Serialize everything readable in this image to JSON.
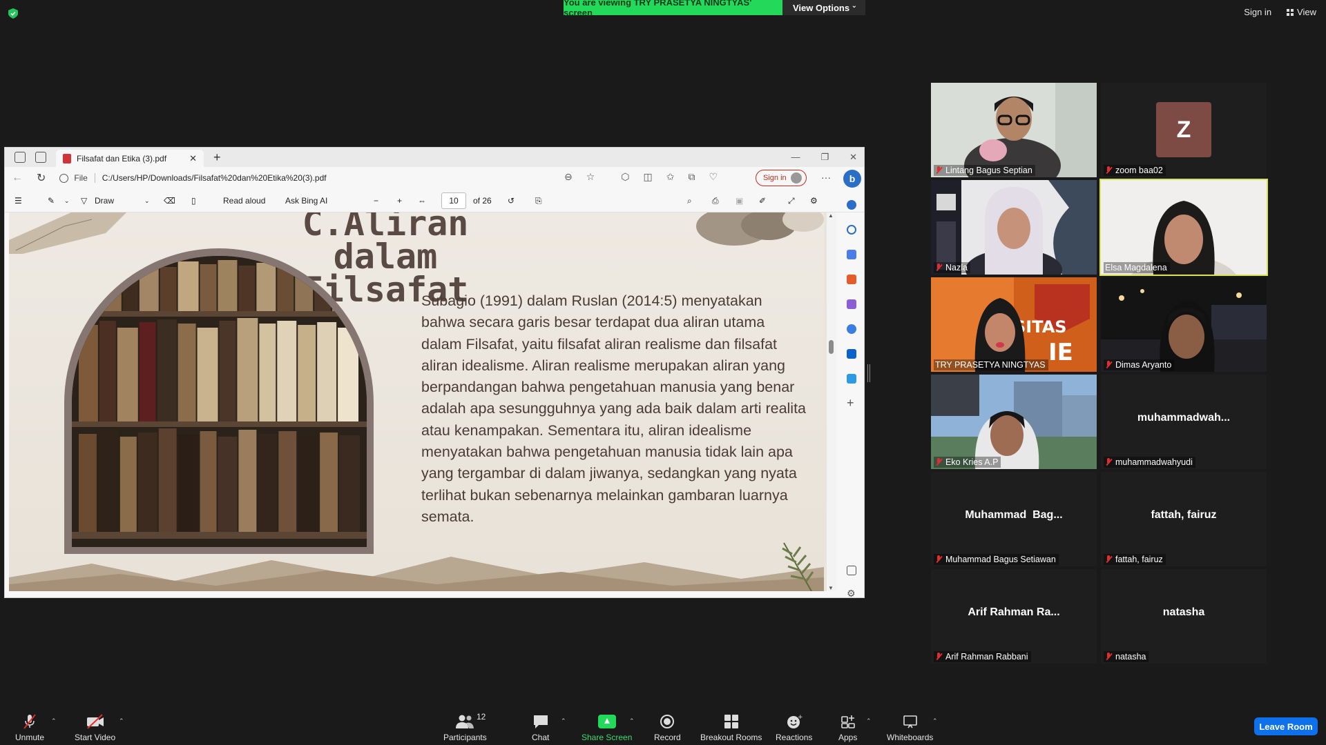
{
  "top": {
    "banner": "You are viewing TRY PRASETYA NINGTYAS' screen",
    "view_options": "View Options",
    "sign_in": "Sign in",
    "view": "View"
  },
  "edge": {
    "tab_title": "Filsafat dan Etika (3).pdf",
    "file_label": "File",
    "url": "C:/Users/HP/Downloads/Filsafat%20dan%20Etika%20(3).pdf",
    "sign_in": "Sign in",
    "toolbar": {
      "draw": "Draw",
      "read_aloud": "Read aloud",
      "ask_bing": "Ask Bing AI",
      "page": "10",
      "of_pages": "of 26"
    }
  },
  "slide": {
    "title_line1": "C.Aliran dalam",
    "title_line2": "Filsafat",
    "body": "Subagio (1991) dalam Ruslan (2014:5) menyatakan bahwa secara garis besar terdapat dua aliran utama dalam Filsafat, yaitu filsafat aliran realisme dan filsafat aliran idealisme. Aliran realisme merupakan aliran yang berpandangan bahwa pengetahuan manusia yang benar adalah apa sesungguhnya yang ada baik dalam arti realita atau kenampakan. Sementara itu, aliran idealisme menyatakan bahwa pengetahuan manusia tidak lain apa yang tergambar di dalam jiwanya, sedangkan yang nyata terlihat bukan sebenarnya melainkan gambaran luarnya semata."
  },
  "participants": [
    {
      "name": "Lintang Bagus Septian",
      "muted": true,
      "video": true
    },
    {
      "name": "zoom baa02",
      "muted": true,
      "video": false,
      "avatar": "Z"
    },
    {
      "name": "Nazla",
      "muted": true,
      "video": true
    },
    {
      "name": "Elsa Magdalena",
      "muted": false,
      "video": true,
      "speaking": true
    },
    {
      "name": "TRY PRASETYA NINGTYAS",
      "muted": false,
      "video": true
    },
    {
      "name": "Dimas Aryanto",
      "muted": true,
      "video": true
    },
    {
      "name": "Eko Kries A.P",
      "muted": true,
      "video": true
    },
    {
      "name": "muhammadwahyudi",
      "muted": true,
      "video": false,
      "display": "muhammadwah..."
    },
    {
      "name": "Muhammad Bagus Setiawan",
      "muted": true,
      "video": false,
      "display": "Muhammad  Bag..."
    },
    {
      "name": "fattah, fairuz",
      "muted": true,
      "video": false,
      "display": "fattah, fairuz"
    },
    {
      "name": "Arif Rahman Rabbani",
      "muted": true,
      "video": false,
      "display": "Arif Rahman Ra..."
    },
    {
      "name": "natasha",
      "muted": true,
      "video": false,
      "display": "natasha"
    }
  ],
  "toolbar": {
    "unmute": "Unmute",
    "start_video": "Start Video",
    "participants": "Participants",
    "participants_count": "12",
    "chat": "Chat",
    "share_screen": "Share Screen",
    "record": "Record",
    "breakout_rooms": "Breakout Rooms",
    "reactions": "Reactions",
    "apps": "Apps",
    "whiteboards": "Whiteboards",
    "leave_room": "Leave Room"
  }
}
